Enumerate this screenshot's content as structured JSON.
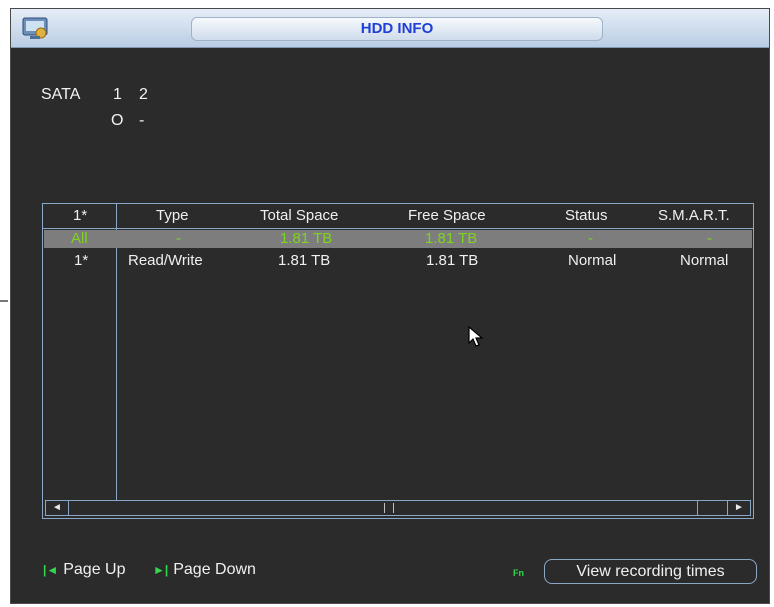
{
  "window": {
    "title": "HDD INFO",
    "app_icon": "hdd-icon"
  },
  "sata": {
    "label": "SATA",
    "columns": [
      "1",
      "2"
    ],
    "statuses": [
      "O",
      "-"
    ]
  },
  "table": {
    "headers": [
      "1*",
      "Type",
      "Total Space",
      "Free Space",
      "Status",
      "S.M.A.R.T."
    ],
    "rows": [
      {
        "id": "All",
        "type": "-",
        "total": "1.81 TB",
        "free": "1.81 TB",
        "status": "-",
        "smart": "-",
        "highlighted": true
      },
      {
        "id": "1*",
        "type": "Read/Write",
        "total": "1.81 TB",
        "free": "1.81 TB",
        "status": "Normal",
        "smart": "Normal",
        "highlighted": false
      }
    ],
    "scroll_left_icon": "◄",
    "scroll_right_icon": "►"
  },
  "footer": {
    "page_up": "Page Up",
    "page_down": "Page Down",
    "page_up_icon": "skip-back-icon",
    "page_down_icon": "skip-forward-icon",
    "fn_label": "Fn",
    "view_button": "View recording times"
  },
  "colors": {
    "background": "#2b2b2b",
    "title_text": "#1f3fd6",
    "highlight_text": "#7ed321",
    "border": "#8aa7c7"
  }
}
